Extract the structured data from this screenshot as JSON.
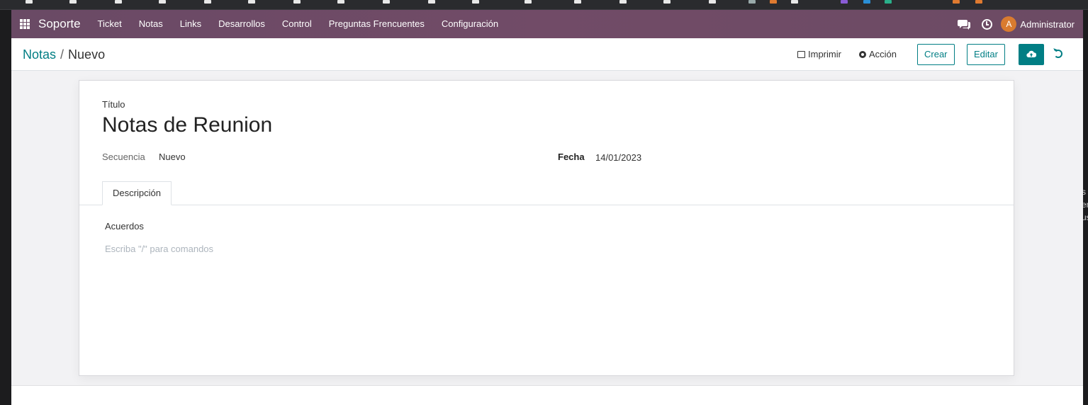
{
  "navbar": {
    "brand": "Soporte",
    "menu": [
      "Ticket",
      "Notas",
      "Links",
      "Desarrollos",
      "Control",
      "Preguntas Frencuentes",
      "Configuración"
    ],
    "user_initial": "A",
    "user_name": "Administrator",
    "accent_color": "#714b67"
  },
  "control": {
    "breadcrumb_parent": "Notas",
    "breadcrumb_separator": "/",
    "breadcrumb_current": "Nuevo",
    "print_label": "Imprimir",
    "action_label": "Acción",
    "create_label": "Crear",
    "edit_label": "Editar",
    "primary_color": "#017e84"
  },
  "form": {
    "title_label": "Título",
    "title_value": "Notas de Reunion",
    "sequence_label": "Secuencia",
    "sequence_value": "Nuevo",
    "date_label": "Fecha",
    "date_value": "14/01/2023",
    "tab_label": "Descripción",
    "editor_content": "Acuerdos",
    "editor_placeholder": "Escriba \"/\" para comandos"
  },
  "right_edge_fragments": [
    "s",
    "en",
    "us"
  ]
}
